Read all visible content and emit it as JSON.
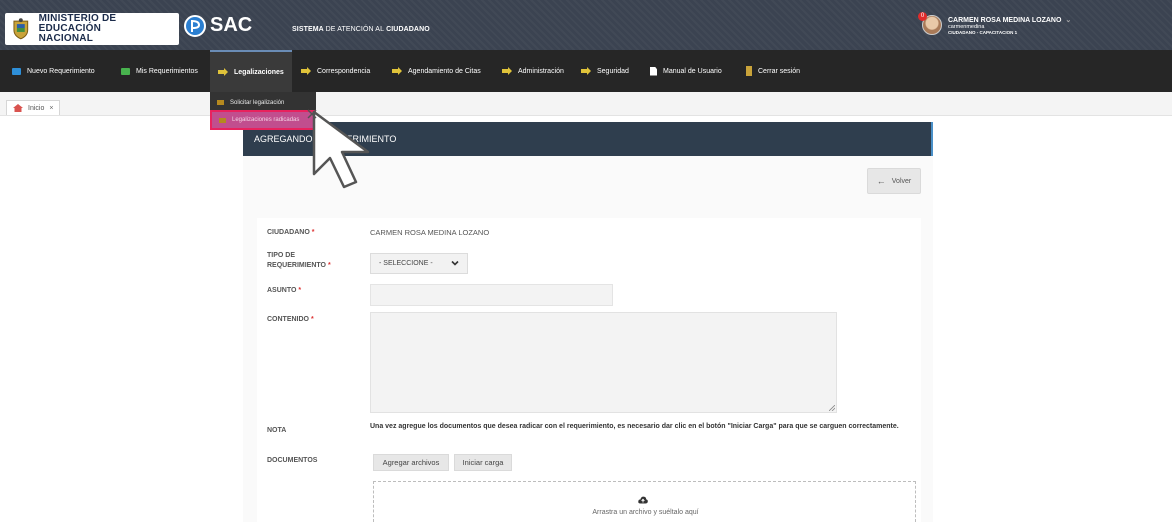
{
  "header": {
    "ministry_line1": "MINISTERIO DE EDUCACIÓN",
    "ministry_line2": "NACIONAL",
    "app_logo": "SAC",
    "app_name_bold1": "SISTEMA",
    "app_name_light": "DE ATENCIÓN AL",
    "app_name_bold2": "CIUDADANO",
    "user": {
      "name": "CARMEN ROSA MEDINA LOZANO",
      "login": "carmenmedina",
      "role": "CIUDADANO - CAPACITACION 1",
      "notifications": "0"
    }
  },
  "nav": {
    "items": [
      {
        "label": "Nuevo Requerimiento",
        "icon": "form-icon"
      },
      {
        "label": "Mis Requerimientos",
        "icon": "list-icon"
      },
      {
        "label": "Legalizaciones",
        "icon": "arrow-icon"
      },
      {
        "label": "Correspondencia",
        "icon": "arrow-icon"
      },
      {
        "label": "Agendamiento de Citas",
        "icon": "arrow-icon"
      },
      {
        "label": "Administración",
        "icon": "arrow-icon"
      },
      {
        "label": "Seguridad",
        "icon": "arrow-icon"
      },
      {
        "label": "Manual de Usuario",
        "icon": "document-icon"
      },
      {
        "label": "Cerrar sesión",
        "icon": "door-icon"
      }
    ],
    "active": "Legalizaciones",
    "dropdown": [
      {
        "label": "Solicitar legalización"
      },
      {
        "label": "Legalizaciones radicadas"
      }
    ]
  },
  "tabs": {
    "home_label": "Inicio",
    "close": "×"
  },
  "panel": {
    "title": "AGREGANDO - REQUERIMIENTO",
    "back_label": "Volver"
  },
  "form": {
    "ciudadano_label": "CIUDADANO",
    "ciudadano_value": "CARMEN ROSA MEDINA LOZANO",
    "tipo_label_line1": "TIPO DE",
    "tipo_label_line2": "REQUERIMIENTO",
    "tipo_value": "- SELECCIONE -",
    "asunto_label": "ASUNTO",
    "asunto_value": "",
    "contenido_label": "CONTENIDO",
    "contenido_value": "",
    "nota_label": "NOTA",
    "nota_text": "Una vez agregue los documentos que desea radicar con el requerimiento, es necesario dar clic en el botón \"Iniciar Carga\" para que se carguen correctamente.",
    "documentos_label": "DOCUMENTOS",
    "add_files_label": "Agregar archivos",
    "start_upload_label": "Iniciar carga",
    "dropzone_text": "Arrastra un archivo y suéltalo aquí",
    "required_mark": "*"
  },
  "colors": {
    "topbar": "#3b4351",
    "navbar": "#262626",
    "panel_head": "#2f3e4e",
    "highlight": "#c14e8e",
    "required": "#d33333"
  }
}
